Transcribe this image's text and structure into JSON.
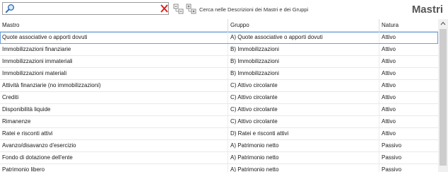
{
  "search": {
    "value": "",
    "placeholder": ""
  },
  "toolbar": {
    "search_description": "Cerca nelle Descrizioni dei Mastri e dei Gruppi"
  },
  "title": "Mastri",
  "columns": {
    "mastro": "Mastro",
    "gruppo": "Gruppo",
    "natura": "Natura"
  },
  "rows": [
    {
      "mastro": "Quote associative o apporti dovuti",
      "gruppo": "A) Quote associative o apporti dovuti",
      "natura": "Attivo"
    },
    {
      "mastro": "Immobilizzazioni finanziarie",
      "gruppo": "B) Immobilizzazioni",
      "natura": "Attivo"
    },
    {
      "mastro": "Immobilizzazioni immateriali",
      "gruppo": "B) Immobilizzazioni",
      "natura": "Attivo"
    },
    {
      "mastro": "Immobilizzazioni materiali",
      "gruppo": "B) Immobilizzazioni",
      "natura": "Attivo"
    },
    {
      "mastro": "Attività finanziarie (no immobilizzazioni)",
      "gruppo": "C) Attivo circolante",
      "natura": "Attivo"
    },
    {
      "mastro": "Crediti",
      "gruppo": "C) Attivo circolante",
      "natura": "Attivo"
    },
    {
      "mastro": "Disponibilità liquide",
      "gruppo": "C) Attivo circolante",
      "natura": "Attivo"
    },
    {
      "mastro": "Rimanenze",
      "gruppo": "C) Attivo circolante",
      "natura": "Attivo"
    },
    {
      "mastro": "Ratei e risconti attivi",
      "gruppo": "D) Ratei e risconti attivi",
      "natura": "Attivo"
    },
    {
      "mastro": "Avanzo/disavanzo d'esercizio",
      "gruppo": "A) Patrimonio netto",
      "natura": "Passivo"
    },
    {
      "mastro": "Fondo di dotazione dell'ente",
      "gruppo": "A) Patrimonio netto",
      "natura": "Passivo"
    },
    {
      "mastro": "Patrimonio libero",
      "gruppo": "A) Patrimonio netto",
      "natura": "Passivo"
    }
  ],
  "selected_row": 0,
  "colors": {
    "accent": "#2f6db5",
    "clear_red": "#e0201b",
    "selection_border": "#6fa0d8"
  },
  "icons": {
    "search": "search-icon",
    "clear": "close-icon",
    "collapse": "collapse-all-icon",
    "expand": "expand-all-icon",
    "scroll_up": "chevron-up-icon"
  }
}
